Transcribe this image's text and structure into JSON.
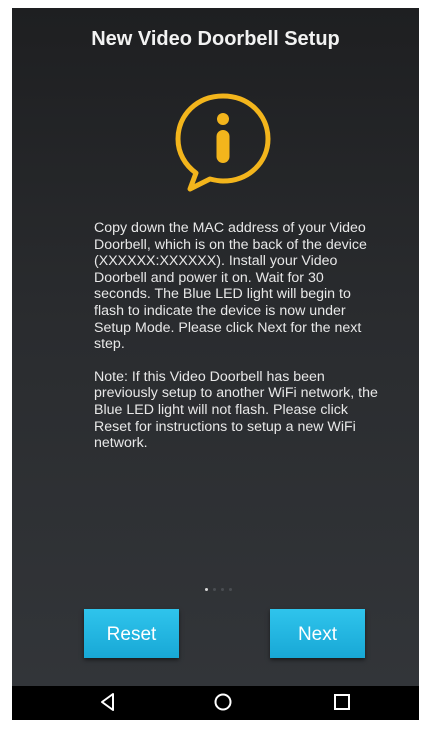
{
  "header": {
    "title": "New Video Doorbell Setup"
  },
  "icon": {
    "name": "info-icon",
    "color": "#f3b51c"
  },
  "message": {
    "paragraph1": "Copy down the MAC address of your Video Doorbell, which is on the back of the device (XXXXXX:XXXXXX). Install your Video Doorbell and power it on. Wait for 30 seconds. The Blue LED light will begin to flash to indicate the device is now under Setup Mode. Please click Next for the next step.",
    "paragraph2": "Note: If this Video Doorbell has been previously setup to another WiFi network, the Blue LED light will not flash. Please click Reset for instructions to setup a new WiFi network."
  },
  "pager": {
    "active_index": 0,
    "count": 4
  },
  "buttons": {
    "reset_label": "Reset",
    "next_label": "Next",
    "color": "#1fb4e0"
  },
  "navbar": {
    "back_icon": "back-icon",
    "home_icon": "home-icon",
    "recents_icon": "recents-icon"
  }
}
